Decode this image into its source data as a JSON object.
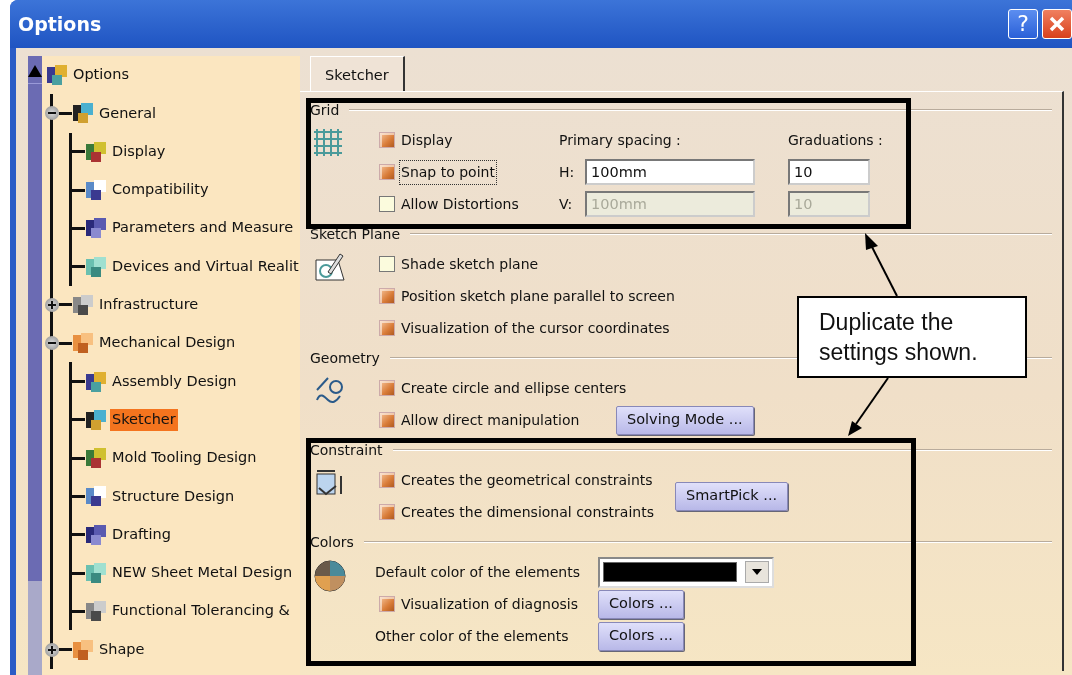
{
  "window": {
    "title": "Options",
    "help_button": "?"
  },
  "tree": [
    {
      "label": "Options",
      "selected": false,
      "children": [
        {
          "label": "General",
          "selected": false,
          "expanded": true,
          "children": [
            {
              "label": "Display",
              "selected": false
            },
            {
              "label": "Compatibility",
              "selected": false
            },
            {
              "label": "Parameters and Measure",
              "selected": false
            },
            {
              "label": "Devices and Virtual Realit",
              "selected": false
            }
          ]
        },
        {
          "label": "Infrastructure",
          "selected": false,
          "expanded": false
        },
        {
          "label": "Mechanical Design",
          "selected": false,
          "expanded": true,
          "children": [
            {
              "label": "Assembly Design",
              "selected": false
            },
            {
              "label": "Sketcher",
              "selected": true
            },
            {
              "label": "Mold Tooling Design",
              "selected": false
            },
            {
              "label": "Structure Design",
              "selected": false
            },
            {
              "label": "Drafting",
              "selected": false
            },
            {
              "label": "NEW Sheet Metal Design",
              "selected": false
            },
            {
              "label": "Functional Tolerancing &",
              "selected": false
            }
          ]
        },
        {
          "label": "Shape",
          "selected": false,
          "expanded": false
        }
      ]
    }
  ],
  "tabs": [
    {
      "label": "Sketcher",
      "selected": true
    }
  ],
  "grid_section": {
    "title": "Grid",
    "spacing_header": "Primary spacing :",
    "graduations_header": "Graduations :",
    "options": [
      {
        "label": "Display",
        "checked": true,
        "focused": false
      },
      {
        "label": "Snap to point",
        "checked": true,
        "focused": true
      },
      {
        "label": "Allow Distortions",
        "checked": false,
        "focused": false
      }
    ],
    "fields": [
      {
        "axis": "H:",
        "spacing": "100mm",
        "graduations": "10",
        "disabled": false
      },
      {
        "axis": "V:",
        "spacing": "100mm",
        "graduations": "10",
        "disabled": true
      }
    ]
  },
  "sections": [
    {
      "kind": "plane",
      "title": "Sketch Plane",
      "rows": [
        {
          "kind": "checkbox",
          "label": "Shade sketch plane",
          "checked": false
        },
        {
          "kind": "checkbox",
          "label": "Position sketch plane parallel to screen",
          "checked": true
        },
        {
          "kind": "checkbox",
          "label": "Visualization of the cursor coordinates",
          "checked": true
        }
      ]
    },
    {
      "kind": "geometry",
      "title": "Geometry",
      "rows": [
        {
          "kind": "checkbox",
          "label": "Create circle and ellipse centers",
          "checked": true
        },
        {
          "kind": "checkbox",
          "label": "Allow direct manipulation",
          "checked": true,
          "button": "Solving Mode ..."
        }
      ]
    },
    {
      "kind": "constraint",
      "title": "Constraint",
      "side_button": "SmartPick ...",
      "rows": [
        {
          "kind": "checkbox",
          "label": "Creates the geometrical constraints",
          "checked": true
        },
        {
          "kind": "checkbox",
          "label": "Creates the dimensional constraints",
          "checked": true
        }
      ]
    },
    {
      "kind": "colors",
      "title": "Colors",
      "rows": [
        {
          "kind": "dropdown",
          "label": "Default color of the elements",
          "color": "#000000"
        },
        {
          "kind": "checkbox",
          "label": "Visualization of diagnosis",
          "checked": true,
          "button": "Colors ..."
        },
        {
          "kind": "text",
          "label": "Other color of the elements",
          "button": "Colors ..."
        }
      ]
    }
  ],
  "callout": "Duplicate the settings shown."
}
